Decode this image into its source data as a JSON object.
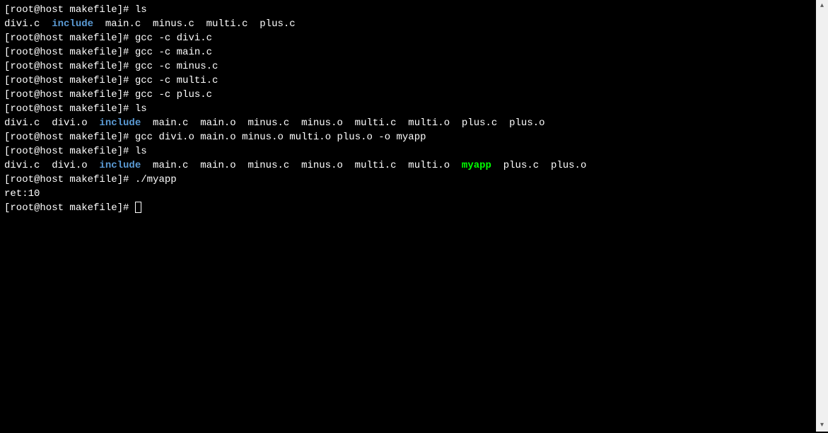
{
  "prompt": "[root@host makefile]# ",
  "lines": [
    {
      "type": "cmd",
      "text": "ls"
    },
    {
      "type": "ls1"
    },
    {
      "type": "cmd",
      "text": "gcc -c divi.c"
    },
    {
      "type": "cmd",
      "text": "gcc -c main.c"
    },
    {
      "type": "cmd",
      "text": "gcc -c minus.c"
    },
    {
      "type": "cmd",
      "text": "gcc -c multi.c"
    },
    {
      "type": "cmd",
      "text": "gcc -c plus.c"
    },
    {
      "type": "cmd",
      "text": "ls"
    },
    {
      "type": "ls2"
    },
    {
      "type": "cmd",
      "text": "gcc divi.o main.o minus.o multi.o plus.o -o myapp"
    },
    {
      "type": "cmd",
      "text": "ls"
    },
    {
      "type": "ls3"
    },
    {
      "type": "cmd",
      "text": "./myapp"
    },
    {
      "type": "output",
      "text": "ret:10"
    },
    {
      "type": "cursor"
    }
  ],
  "ls1": {
    "f1": "divi.c  ",
    "dir": "include",
    "f2": "  main.c  minus.c  multi.c  plus.c"
  },
  "ls2": {
    "f1": "divi.c  divi.o  ",
    "dir": "include",
    "f2": "  main.c  main.o  minus.c  minus.o  multi.c  multi.o  plus.c  plus.o"
  },
  "ls3": {
    "f1": "divi.c  divi.o  ",
    "dir": "include",
    "f2": "  main.c  main.o  minus.c  minus.o  multi.c  multi.o  ",
    "exec": "myapp",
    "f3": "  plus.c  plus.o"
  },
  "scroll": {
    "up": "▴",
    "down": "▾"
  }
}
